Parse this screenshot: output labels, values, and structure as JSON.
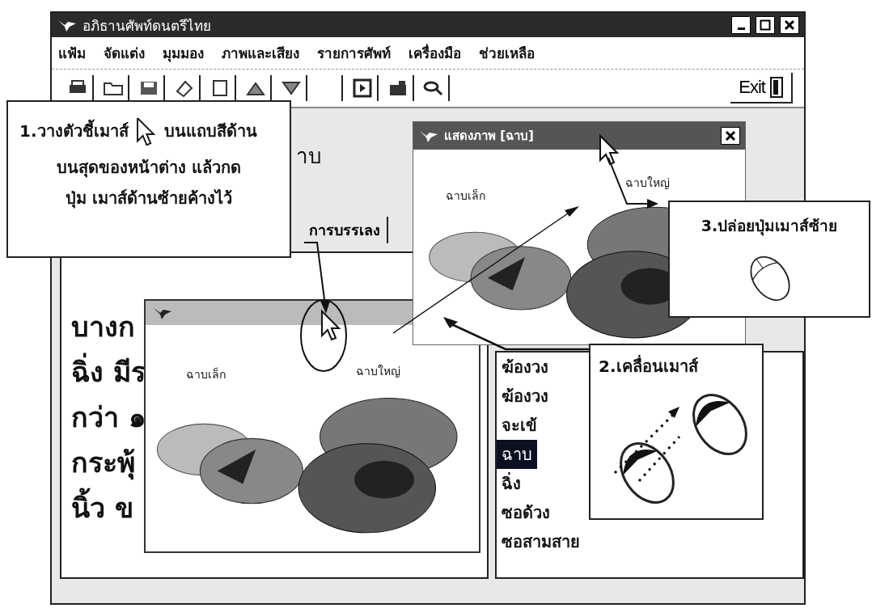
{
  "window": {
    "title": "อภิธานศัพท์ดนตรีไทย"
  },
  "menu": [
    {
      "label": "แฟ้ม"
    },
    {
      "label": "จัดแต่ง"
    },
    {
      "label": "มุมมอง"
    },
    {
      "label": "ภาพและเสียง"
    },
    {
      "label": "รายการศัพท์"
    },
    {
      "label": "เครื่องมือ"
    },
    {
      "label": "ช่วยเหลือ"
    }
  ],
  "toolbar": {
    "exit_label": "Exit"
  },
  "entry": {
    "heading": "าบ",
    "tabs": [
      {
        "label": "การบรรเลง"
      }
    ],
    "text_lines": [
      "บางก",
      "ฉิ่ง มีร",
      "กว่า ๑",
      "กระพุ้",
      "นิ้ว ข"
    ]
  },
  "term_list": [
    {
      "label": "ฆ้องวง",
      "selected": false
    },
    {
      "label": "ฆ้องวง",
      "selected": false
    },
    {
      "label": "จะเข้",
      "selected": false
    },
    {
      "label": "ฉาบ",
      "selected": true
    },
    {
      "label": "ฉิ่ง",
      "selected": false
    },
    {
      "label": "ซอด้วง",
      "selected": false
    },
    {
      "label": "ซอสามสาย",
      "selected": false
    }
  ],
  "picture_window": {
    "title": "แสดงภาพ [ฉาบ]",
    "labels": [
      "ฉาบเล็ก",
      "ฉาบใหญ่"
    ]
  },
  "drag_outline": {
    "labels": [
      "ฉาบเล็ก",
      "ฉาบใหญ่"
    ]
  },
  "callouts": [
    {
      "kind": "press",
      "before_icon": "1.วางตัวชี้เมาส์",
      "after_icon": "บนแถบสีด้าน",
      "text": "บนสุดของหน้าต่าง แล้วกดปุ่ม เมาส์ด้านซ้ายค้างไว้"
    },
    {
      "kind": "release",
      "text": "3.ปล่อยปุ่มเมาส์ซ้าย"
    },
    {
      "kind": "drag",
      "text": "2.เคลื่อนเมาส์"
    }
  ]
}
